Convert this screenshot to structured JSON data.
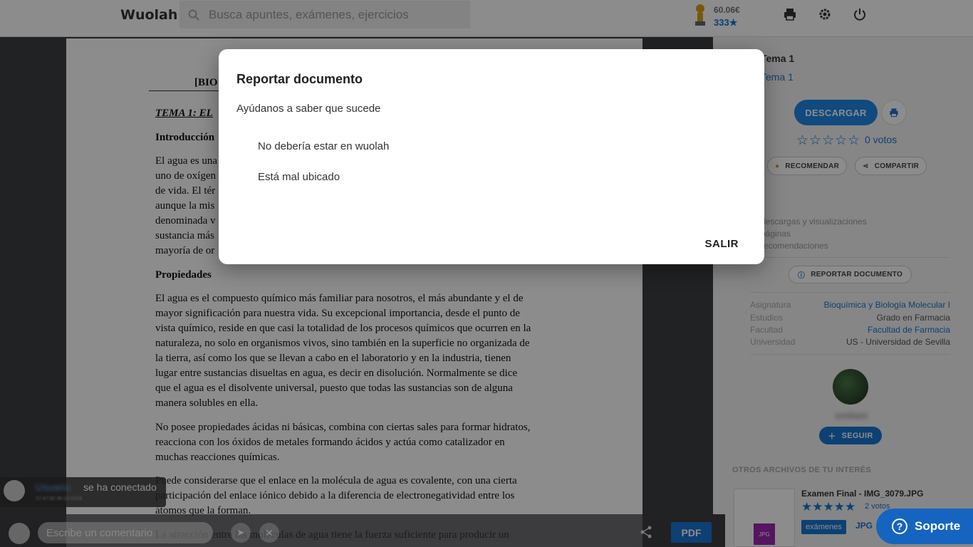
{
  "header": {
    "logo": "Wuolah",
    "search_placeholder": "Busca apuntes, exámenes, ejercicios",
    "balance": "60.06€",
    "stars": "333★"
  },
  "document": {
    "lines": [
      {
        "text": "[BIO",
        "style": "bold"
      },
      {
        "text": "TEMA 1: EL",
        "style": "ital"
      },
      {
        "text": "Introducción",
        "style": "bold"
      },
      {
        "text": "El agua es una",
        "style": ""
      },
      {
        "text": "uno de oxígen",
        "style": ""
      },
      {
        "text": "de vida. El tér",
        "style": ""
      },
      {
        "text": "aunque la mis",
        "style": ""
      },
      {
        "text": "denominada v",
        "style": ""
      },
      {
        "text": "sustancia más",
        "style": ""
      },
      {
        "text": "mayoría de or",
        "style": ""
      },
      {
        "text": "Propiedades",
        "style": "bold"
      },
      {
        "text": "El agua es el compuesto químico más familiar para nosotros, el más abundante y el de",
        "style": ""
      },
      {
        "text": "mayor significación para nuestra vida. Su excepcional importancia, desde el punto de",
        "style": ""
      },
      {
        "text": "vista químico, reside en que casi la totalidad de los procesos químicos que ocurren en la",
        "style": ""
      },
      {
        "text": "naturaleza, no solo en organismos vivos, sino también en la superficie no organizada de",
        "style": ""
      },
      {
        "text": "la tierra, así como los que se llevan a cabo en el laboratorio y en la industria, tienen",
        "style": ""
      },
      {
        "text": "lugar entre sustancias disueltas en agua, es decir en disolución. Normalmente se dice",
        "style": ""
      },
      {
        "text": "que el agua es el disolvente universal, puesto que todas las sustancias son de alguna",
        "style": ""
      },
      {
        "text": "manera solubles en ella.",
        "style": ""
      },
      {
        "text": "No posee propiedades ácidas ni básicas, combina con ciertas sales para formar hidratos,",
        "style": ""
      },
      {
        "text": "reacciona con los óxidos de metales formando ácidos y actúa como catalizador en",
        "style": ""
      },
      {
        "text": "muchas reacciones químicas.",
        "style": ""
      },
      {
        "text": "Puede considerarse que el enlace en la molécula de agua es covalente, con una cierta",
        "style": ""
      },
      {
        "text": "participación del enlace iónico debido a la diferencia de electronegatividad entre los",
        "style": ""
      },
      {
        "text": "átomos que la forman.",
        "style": ""
      },
      {
        "text": "La atracción entre las moléculas de agua tiene la fuerza suficiente para producir un",
        "style": ""
      }
    ]
  },
  "sidebar": {
    "title": "Tema 1",
    "subtitle": "Tema 1",
    "download_label": "DESCARGAR",
    "rating_stars": "☆☆☆☆☆",
    "votes": "0 votos",
    "recommend_label": "RECOMENDAR",
    "share_label": "COMPARTIR",
    "stats": [
      "descargas y visualizaciones",
      "páginas",
      "recomendaciones"
    ],
    "report_label": "REPORTAR DOCUMENTO",
    "details": [
      {
        "label": "Asignatura",
        "value": "Bioquímica y Biología Molecular I",
        "link": true
      },
      {
        "label": "Estudios",
        "value": "Grado en Farmacia",
        "link": false
      },
      {
        "label": "Facultad",
        "value": "Facultad de Farmacia",
        "link": true
      },
      {
        "label": "Universidad",
        "value": "US - Universidad de Sevilla",
        "link": false
      }
    ],
    "username": "emiliant",
    "follow_label": "SEGUIR",
    "related_heading": "OTROS ARCHIVOS DE TU INTERÉS",
    "related": {
      "title": "Examen Final - IMG_3079.JPG",
      "stars": "★★★★★",
      "votes": "2 votos",
      "tag": "exámenes",
      "ext": "JPG",
      "thumb_label": "JPG"
    }
  },
  "support": {
    "label": "Soporte"
  },
  "bottombar": {
    "comment_placeholder": "Escribe un comentario",
    "pdf_label": "PDF"
  },
  "toast": {
    "name": "Usuario",
    "message": "se ha conectado",
    "time": "17:47:00 30-10-2018"
  },
  "modal": {
    "title": "Reportar documento",
    "description": "Ayúdanos a saber que sucede",
    "options": [
      "No debería estar en wuolah",
      "Está mal ubicado"
    ],
    "exit_label": "SALIR"
  }
}
